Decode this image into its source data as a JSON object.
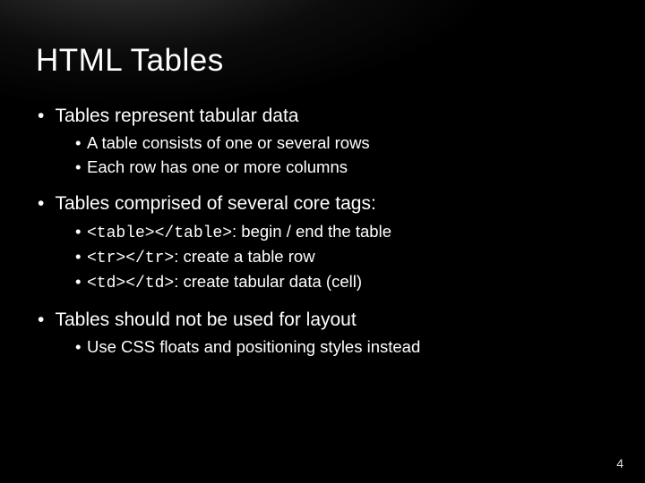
{
  "title": "HTML Tables",
  "page_number": "4",
  "bullets": [
    {
      "text": "Tables represent tabular data",
      "sub": [
        {
          "text": "A table consists of one or several rows"
        },
        {
          "text": "Each row has one or more columns"
        }
      ]
    },
    {
      "text": "Tables comprised of several core tags:",
      "sub": [
        {
          "code": "<table></table>",
          "text": ": begin / end the table"
        },
        {
          "code": "<tr></tr>",
          "text": ": create a table row"
        },
        {
          "code": "<td></td>",
          "text": ": create tabular data (cell)"
        }
      ]
    },
    {
      "text": "Tables should not be used for layout",
      "sub": [
        {
          "text": "Use CSS floats and positioning styles instead"
        }
      ]
    }
  ]
}
